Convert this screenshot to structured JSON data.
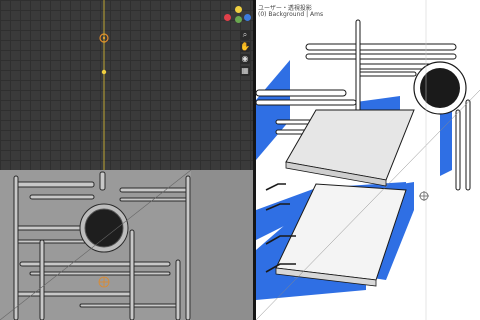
{
  "left_viewport": {
    "background": "#3a3a3a",
    "gizmo": {
      "x_color": "#e0404a",
      "y_color": "#6aa84f",
      "z_color": "#3d7bdc",
      "extra_color": "#f0d040"
    },
    "tools": [
      {
        "icon": "zoom-icon",
        "glyph": "⌕"
      },
      {
        "icon": "hand-icon",
        "glyph": "✋"
      },
      {
        "icon": "camera-icon",
        "glyph": "◉"
      },
      {
        "icon": "grid-icon",
        "glyph": "▦"
      }
    ],
    "camera_view_background": "#9a9a9a"
  },
  "right_viewport": {
    "background": "#ffffff",
    "accent_blue": "#2f6fe4",
    "hud": {
      "line1": "ユーザー・透視投影",
      "line2": "(0) Background | Ams"
    }
  }
}
